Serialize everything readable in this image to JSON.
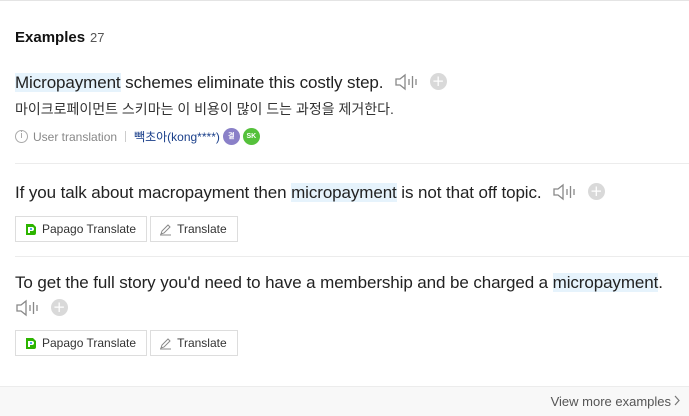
{
  "section": {
    "title": "Examples",
    "count": "27"
  },
  "examples": [
    {
      "highlight": "Micropayment",
      "rest": " schemes eliminate this costly step.",
      "translation": "마이크로페이먼트 스키마는 이 비용이 많이 드는 과정을 제거한다.",
      "meta": {
        "source_label": "User translation",
        "user": "빽초아(kong****)",
        "badge1": "결",
        "badge2": "SK"
      }
    },
    {
      "before": "If you talk about macropayment then ",
      "highlight": "micropayment",
      "after": " is not that off topic.",
      "buttons": {
        "papago": "Papago Translate",
        "translate": "Translate"
      }
    },
    {
      "before": "To get the full story you'd need to have a membership and be charged a ",
      "highlight": "micropayment",
      "after": ".",
      "buttons": {
        "papago": "Papago Translate",
        "translate": "Translate"
      }
    }
  ],
  "footer": {
    "view_more": "View more examples"
  },
  "colors": {
    "highlight": "#e6f3fc",
    "user_link": "#1a3f8a",
    "badge_purple": "#8a80c8",
    "badge_green": "#55c13b"
  },
  "icons": [
    "speaker-icon",
    "plus-icon",
    "info-icon",
    "papago-icon",
    "pencil-icon",
    "chevron-right-icon"
  ]
}
